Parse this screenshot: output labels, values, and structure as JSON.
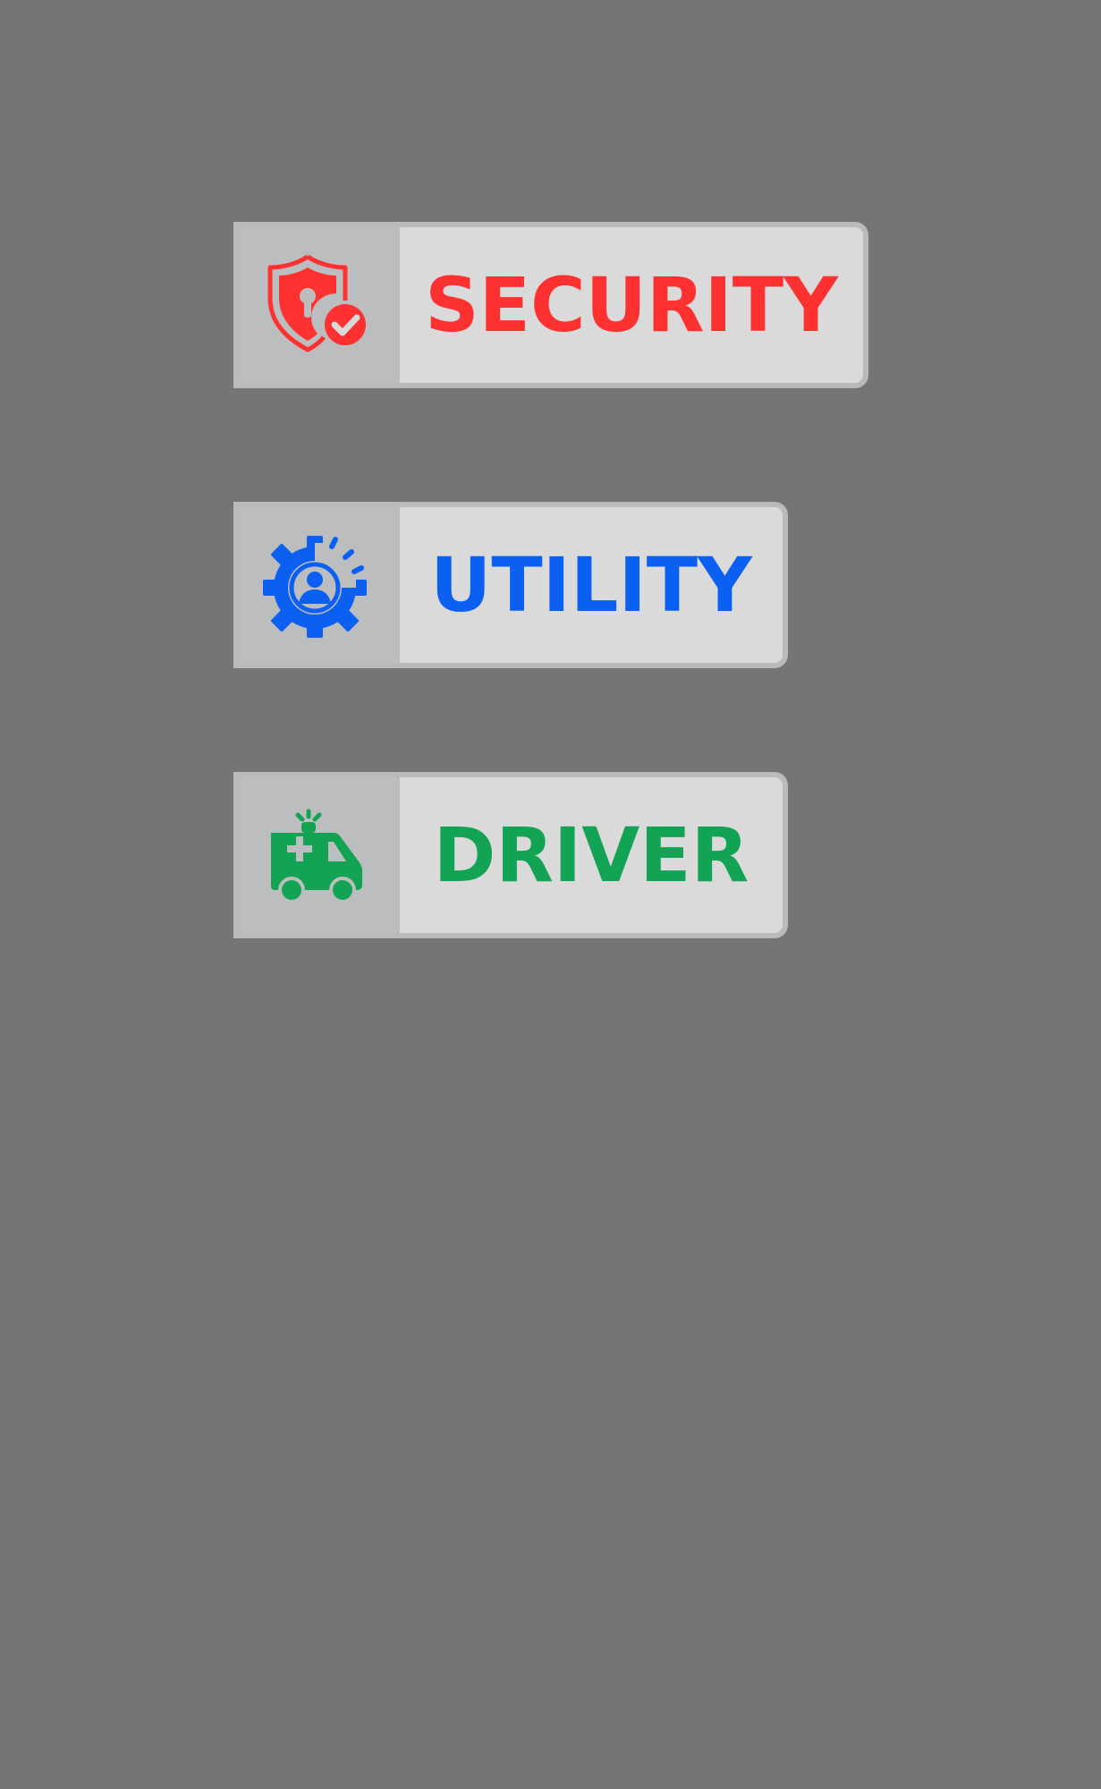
{
  "buttons": {
    "security": {
      "label": "SECURITY",
      "icon": "shield-lock-check-icon",
      "color": "#ff3131"
    },
    "utility": {
      "label": "UTILITY",
      "icon": "gear-user-icon",
      "color": "#0b60f2"
    },
    "driver": {
      "label": "DRIVER",
      "icon": "ambulance-icon",
      "color": "#12a454"
    }
  },
  "colors": {
    "background": "#757575",
    "button_fill": "#dadada",
    "icon_panel": "#bcbdbf",
    "button_border": "#b9babc"
  }
}
